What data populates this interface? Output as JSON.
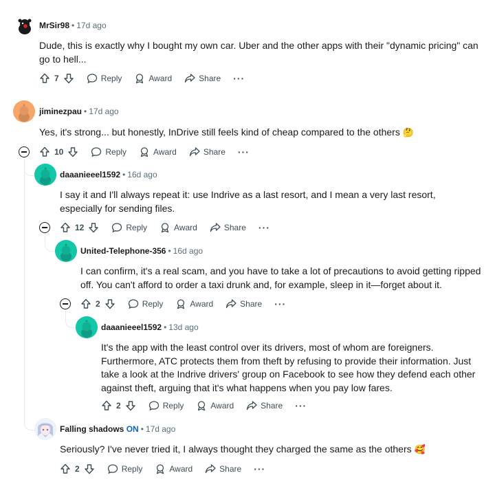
{
  "comments": [
    {
      "username": "MrSir98",
      "time": "17d ago",
      "text": "Dude, this is exactly why I bought my own car. Uber and the other apps with their \"dynamic pricing\" can go to hell...",
      "votes": "7",
      "reply": "Reply",
      "award": "Award",
      "share": "Share",
      "more": "···"
    },
    {
      "username": "jiminezpau",
      "time": "17d ago",
      "text": "Yes, it's strong... but honestly, InDrive still feels kind of cheap compared to the others",
      "emoji": "🤔",
      "votes": "10",
      "reply": "Reply",
      "award": "Award",
      "share": "Share",
      "more": "···"
    },
    {
      "username": "daaanieeel1592",
      "time": "16d ago",
      "text": "I say it and I'll always repeat it: use Indrive as a last resort, and I mean a very last resort, especially for sending files.",
      "votes": "12",
      "reply": "Reply",
      "award": "Award",
      "share": "Share",
      "more": "···"
    },
    {
      "username": "United-Telephone-356",
      "time": "16d ago",
      "text": "I can confirm, it's a real scam, and you have to take a lot of precautions to avoid getting ripped off. You can't afford to order a taxi drunk and, for example, sleep in it—forget about it.",
      "votes": "2",
      "reply": "Reply",
      "award": "Award",
      "share": "Share",
      "more": "···"
    },
    {
      "username": "daaanieeel1592",
      "time": "13d ago",
      "text": "It's the app with the least control over its drivers, most of whom are foreigners. Furthermore, ATC protects them from theft by refusing to provide their information. Just take a look at the Indrive drivers' group on Facebook to see how they defend each other against theft, arguing that it's what happens when you pay low fares.",
      "votes": "2",
      "reply": "Reply",
      "award": "Award",
      "share": "Share",
      "more": "···"
    },
    {
      "username": "Falling shadows",
      "flair": "ON",
      "time": "17d ago",
      "text": "Seriously? I've never tried it, I always thought they charged the same as the others",
      "emoji": "🥰",
      "votes": "2",
      "reply": "Reply",
      "award": "Award",
      "share": "Share",
      "more": "···"
    }
  ],
  "colors": {
    "snoo_teal": "#14c7a8",
    "snoo_orange": "#f7a66a",
    "meta_gray": "#576f76",
    "thread_line": "#e5ebee"
  }
}
